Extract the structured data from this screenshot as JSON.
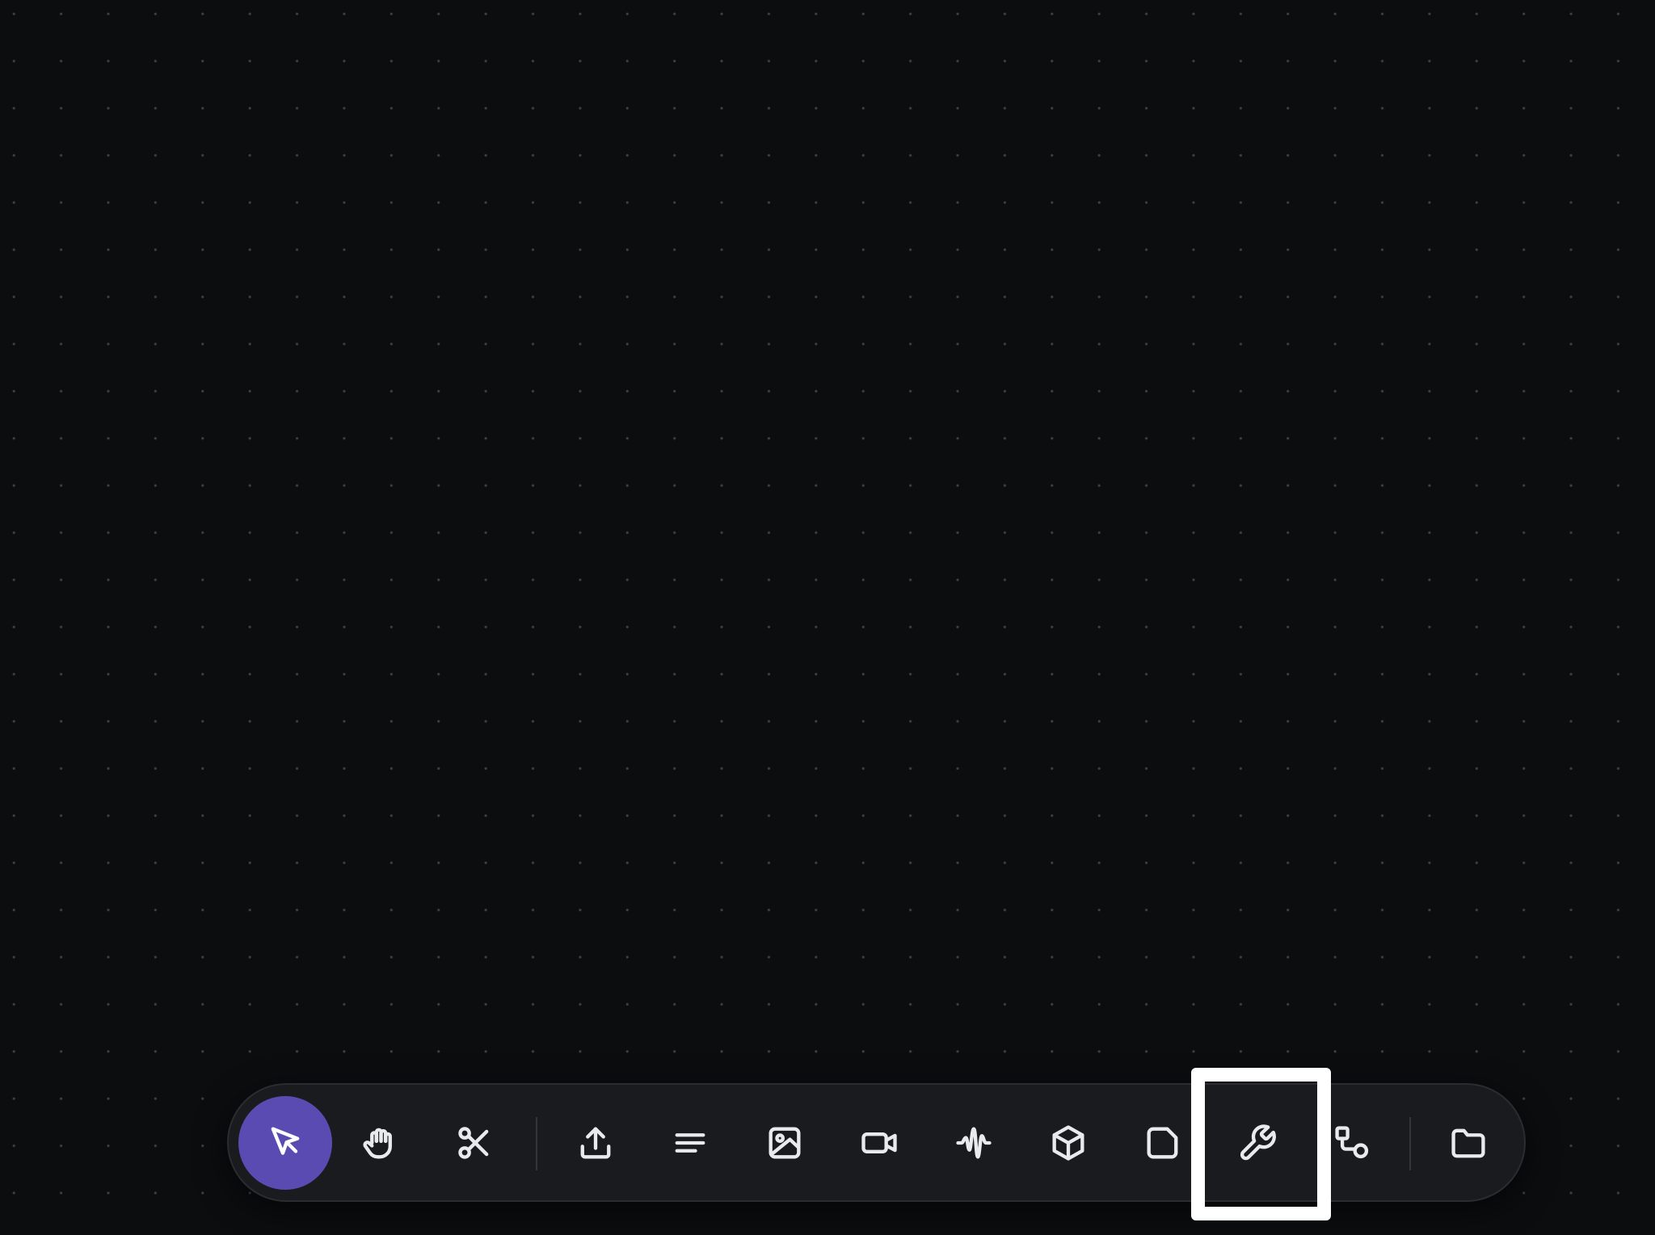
{
  "app": {
    "canvas": {
      "style": "dot-grid",
      "background": "#0c0d0f",
      "dot_color": "#787e86"
    }
  },
  "toolbar": {
    "accent": "#5a4bb3",
    "active_tool": "select",
    "highlighted_tool": "tools",
    "groups": [
      {
        "name": "navigation",
        "items": [
          {
            "id": "select",
            "icon": "cursor-icon"
          },
          {
            "id": "pan",
            "icon": "hand-icon"
          },
          {
            "id": "cut",
            "icon": "scissors-icon"
          }
        ]
      },
      {
        "name": "insert",
        "items": [
          {
            "id": "upload",
            "icon": "upload-icon"
          },
          {
            "id": "text",
            "icon": "text-lines-icon"
          },
          {
            "id": "image",
            "icon": "image-icon"
          },
          {
            "id": "video",
            "icon": "video-camera-icon"
          },
          {
            "id": "audio",
            "icon": "audio-waveform-icon"
          },
          {
            "id": "3d",
            "icon": "cube-icon"
          },
          {
            "id": "note",
            "icon": "sticky-note-icon"
          },
          {
            "id": "tools",
            "icon": "wrench-icon"
          },
          {
            "id": "flow",
            "icon": "flow-connector-icon"
          }
        ]
      },
      {
        "name": "files",
        "items": [
          {
            "id": "folder",
            "icon": "folder-icon"
          }
        ]
      }
    ]
  }
}
